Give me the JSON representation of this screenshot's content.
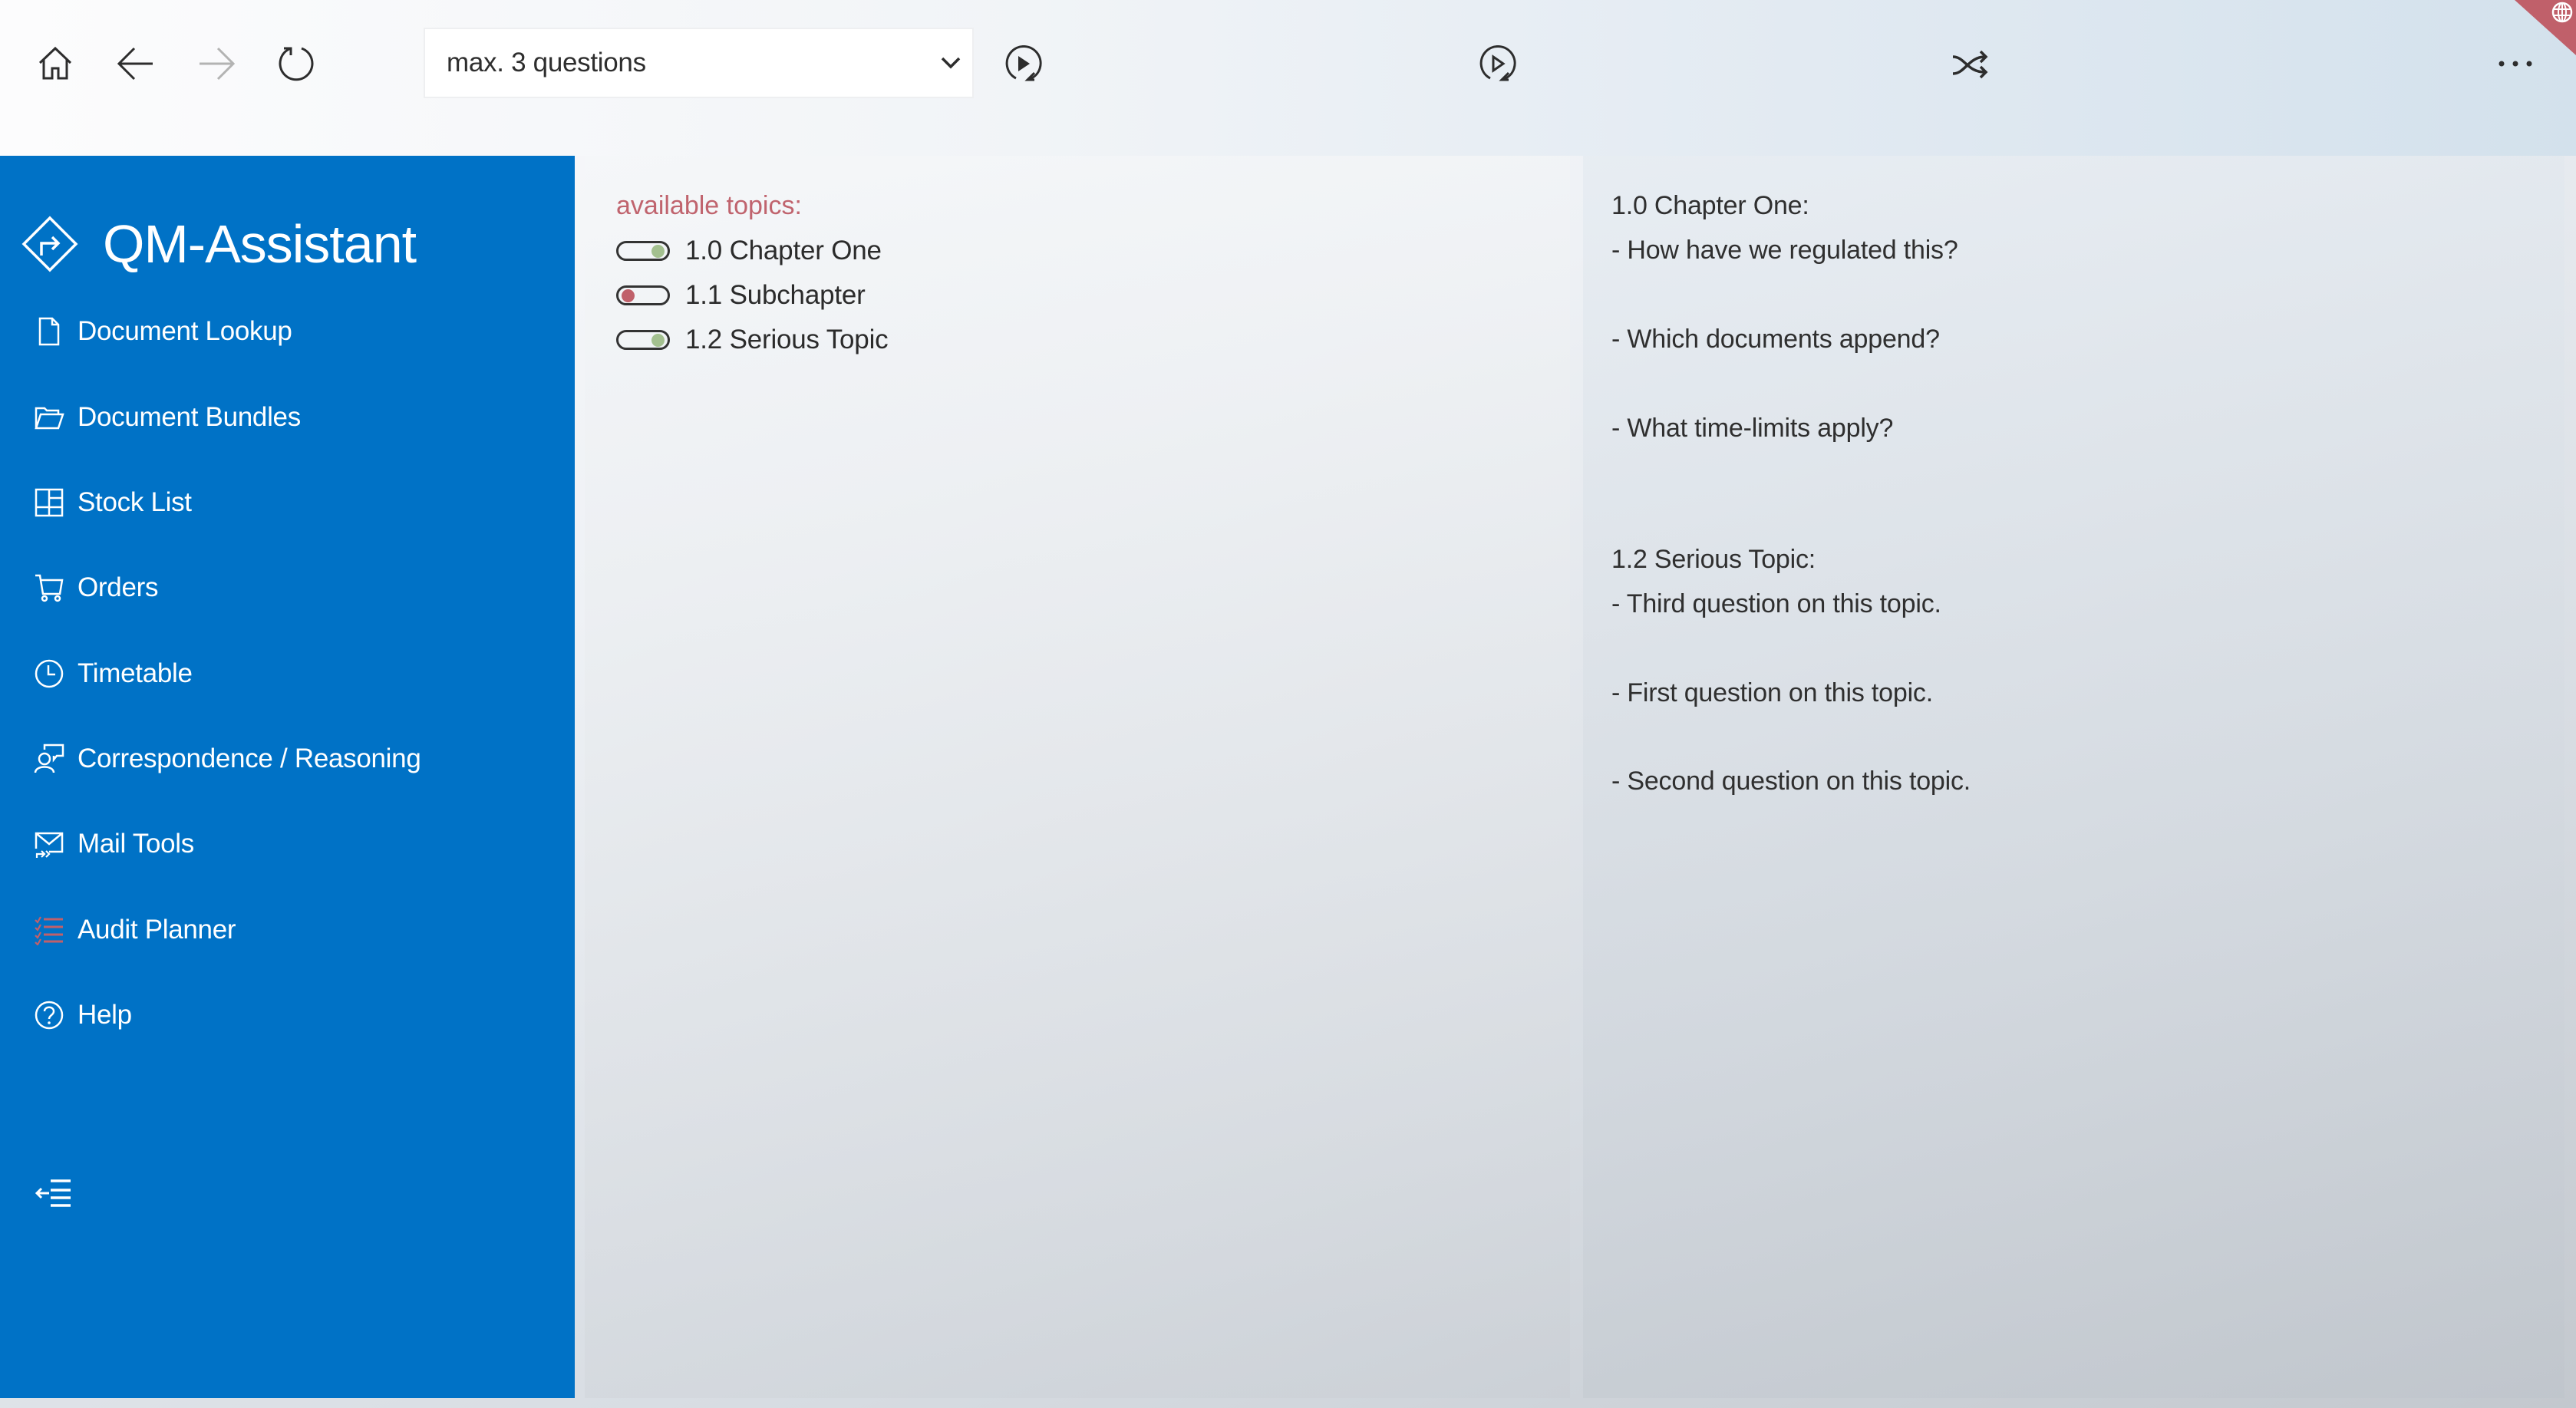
{
  "toolbar": {
    "home_icon": "home-icon",
    "back_icon": "arrow-left-icon",
    "forward_icon": "arrow-right-icon",
    "refresh_icon": "refresh-icon",
    "question_limit": {
      "selected": "max. 3 questions"
    },
    "play_repeat_icon": "play-repeat-filled-icon",
    "play_repeat_outline_icon": "play-repeat-outline-icon",
    "shuffle_icon": "shuffle-icon",
    "more_icon": "more-ellipsis-icon",
    "corner_icon": "globe-icon"
  },
  "sidebar": {
    "app_title": "QM-Assistant",
    "brand_icon": "directions-diamond-icon",
    "items": [
      {
        "label": "Document Lookup",
        "icon": "document-icon"
      },
      {
        "label": "Document Bundles",
        "icon": "folder-open-icon"
      },
      {
        "label": "Stock List",
        "icon": "grid-icon"
      },
      {
        "label": "Orders",
        "icon": "cart-icon"
      },
      {
        "label": "Timetable",
        "icon": "clock-icon"
      },
      {
        "label": "Correspondence / Reasoning",
        "icon": "person-chat-icon"
      },
      {
        "label": "Mail Tools",
        "icon": "mail-forward-icon"
      },
      {
        "label": "Audit Planner",
        "icon": "checklist-icon",
        "active": true
      },
      {
        "label": "Help",
        "icon": "help-icon"
      }
    ],
    "collapse_icon": "collapse-menu-icon"
  },
  "topics": {
    "label": "available topics:",
    "items": [
      {
        "label": "1.0 Chapter One",
        "enabled": true
      },
      {
        "label": "1.1 Subchapter",
        "enabled": false
      },
      {
        "label": "1.2 Serious Topic",
        "enabled": true
      }
    ]
  },
  "questions": {
    "lines": [
      "1.0 Chapter One:",
      "- How have we regulated this?",
      "- Which documents append?",
      "- What time-limits apply?",
      "1.2 Serious Topic:",
      "- Third question on this topic.",
      "- First question on this topic.",
      "- Second question on this topic."
    ]
  },
  "colors": {
    "sidebar_bg": "#0072c6",
    "topics_label": "#c0646e",
    "toggle_on": "#a3c08f",
    "toggle_off": "#c0606a",
    "corner_badge": "#c0606a"
  }
}
